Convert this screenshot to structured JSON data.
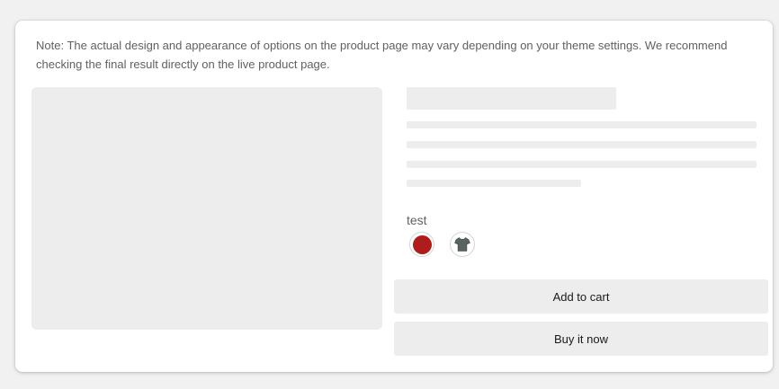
{
  "note": {
    "text": "Note: The actual design and appearance of options on the product page may vary depending on your theme settings. We recommend checking the final result directly on the live product page."
  },
  "option": {
    "label": "test",
    "swatches": [
      {
        "name": "red",
        "color": "#b01c1c"
      },
      {
        "name": "shirt-image",
        "icon": "tshirt-icon",
        "color": "#5a6361"
      }
    ]
  },
  "actions": {
    "add_to_cart": "Add to cart",
    "buy_now": "Buy it now"
  }
}
